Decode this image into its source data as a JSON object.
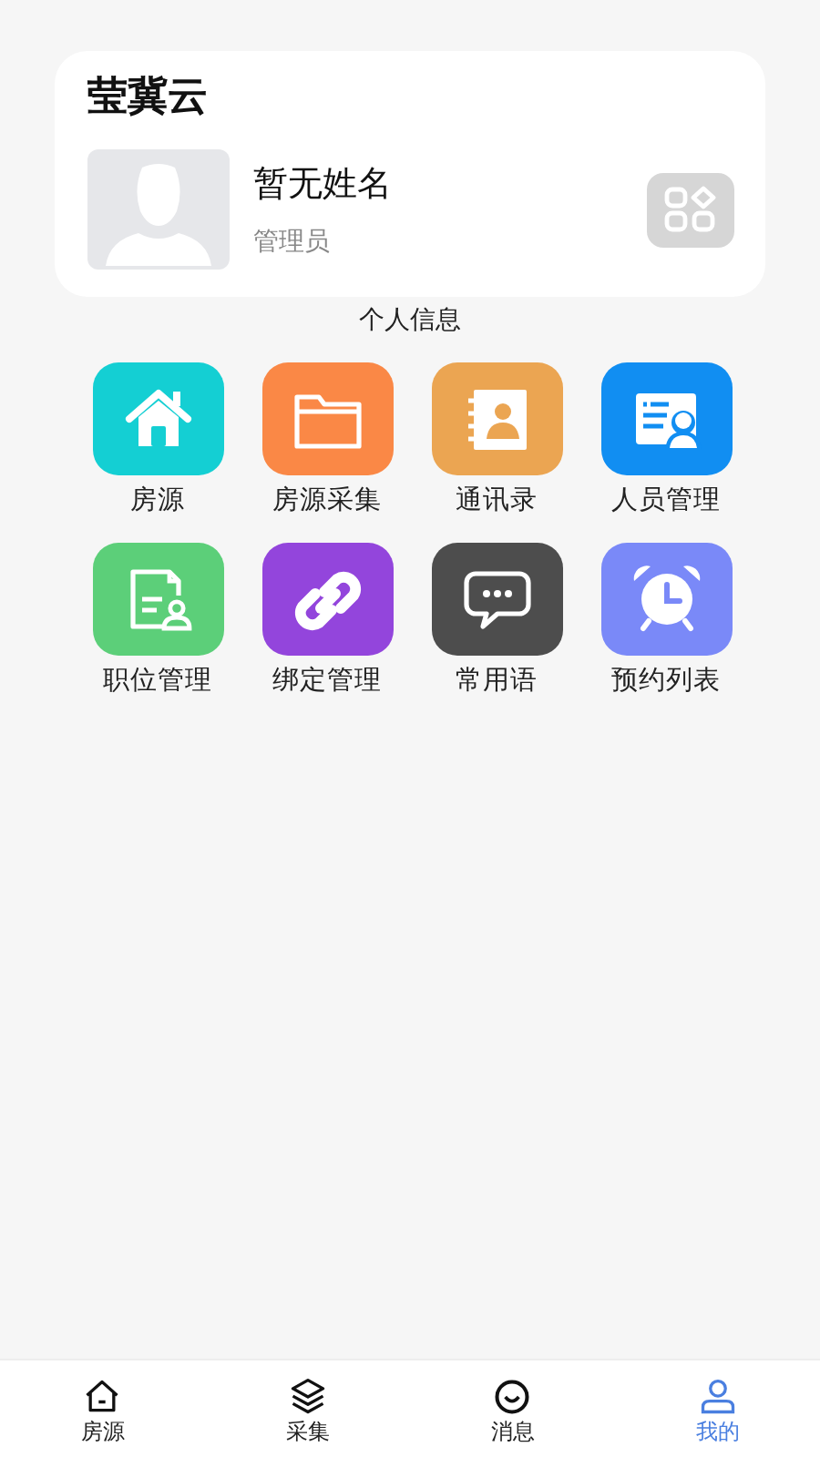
{
  "profile_card": {
    "app_name": "莹冀云",
    "user_name": "暂无姓名",
    "role": "管理员"
  },
  "section_label": "个人信息",
  "features": [
    {
      "label": "房源",
      "color": "#14cfd3"
    },
    {
      "label": "房源采集",
      "color": "#fa8846"
    },
    {
      "label": "通讯录",
      "color": "#eba552"
    },
    {
      "label": "人员管理",
      "color": "#118ef2"
    },
    {
      "label": "职位管理",
      "color": "#5ccf79"
    },
    {
      "label": "绑定管理",
      "color": "#9345dc"
    },
    {
      "label": "常用语",
      "color": "#4d4d4d"
    },
    {
      "label": "预约列表",
      "color": "#7a89f8"
    }
  ],
  "tab_bar": [
    {
      "label": "房源",
      "selected": false
    },
    {
      "label": "采集",
      "selected": false
    },
    {
      "label": "消息",
      "selected": false
    },
    {
      "label": "我的",
      "selected": true
    }
  ]
}
